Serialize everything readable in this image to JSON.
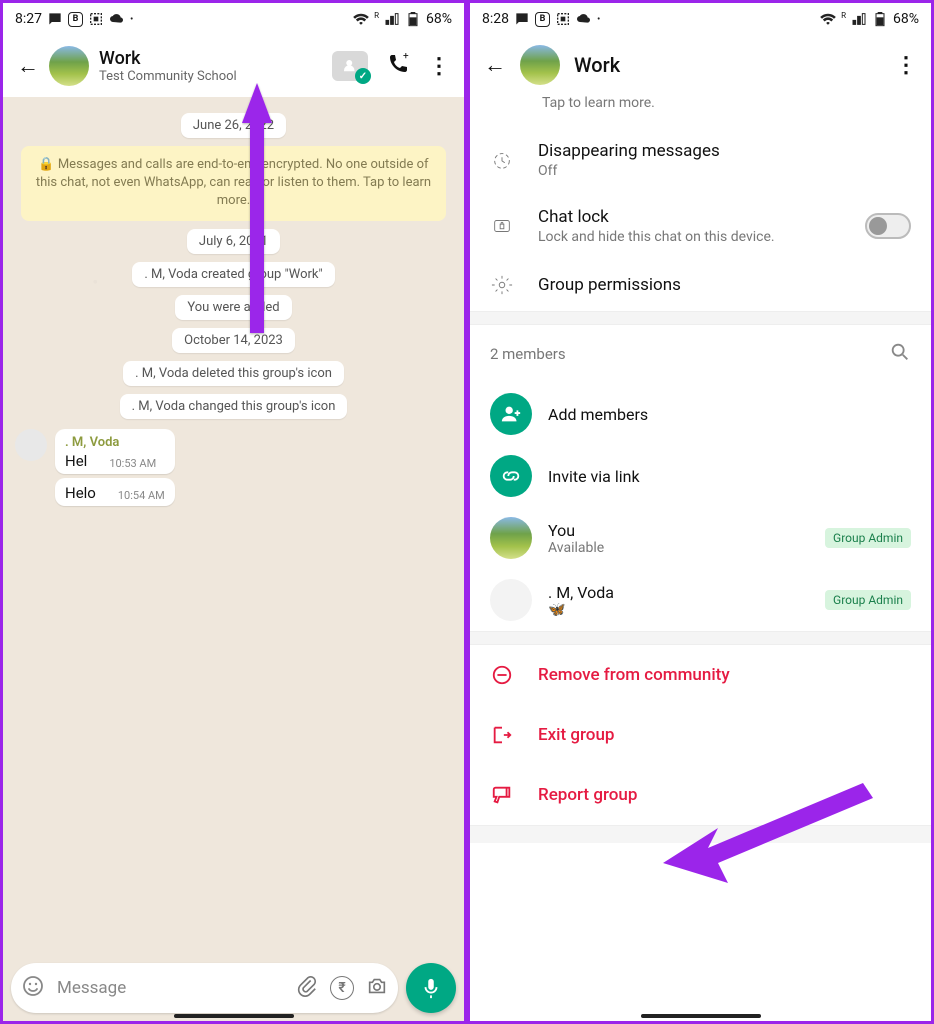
{
  "left": {
    "statusbar": {
      "time": "8:27",
      "battery": "68%",
      "roam": "R"
    },
    "header": {
      "title": "Work",
      "subtitle": "Test Community School"
    },
    "chat": {
      "dates": {
        "d1": "June 26, 2022",
        "d2": "July 6, 2021",
        "d3": "October 14, 2023"
      },
      "encryption": "🔒 Messages and calls are end-to-end encrypted. No one outside of this chat, not even WhatsApp, can read or listen to them. Tap to learn more.",
      "sys": {
        "created": ". M, Voda created group \"Work\"",
        "added": "You were added",
        "deleted_icon": ". M, Voda deleted this group's icon",
        "changed_icon": ". M, Voda changed this group's icon"
      },
      "message": {
        "sender": ". M, Voda",
        "m1_text": "Hel",
        "m1_time": "10:53 AM",
        "m2_text": "Helo",
        "m2_time": "10:54 AM"
      },
      "input_placeholder": "Message"
    }
  },
  "right": {
    "statusbar": {
      "time": "8:28",
      "battery": "68%",
      "roam": "R"
    },
    "header": {
      "title": "Work",
      "tap_sub": "Tap to learn more."
    },
    "options": {
      "disappearing": {
        "title": "Disappearing messages",
        "sub": "Off"
      },
      "chatlock": {
        "title": "Chat lock",
        "sub": "Lock and hide this chat on this device."
      },
      "permissions": {
        "title": "Group permissions"
      }
    },
    "members": {
      "count": "2 members",
      "add": "Add members",
      "invite": "Invite via link",
      "you": {
        "name": "You",
        "sub": "Available",
        "badge": "Group Admin"
      },
      "m2": {
        "name": ". M, Voda",
        "sub": "🦋",
        "badge": "Group Admin"
      }
    },
    "actions": {
      "remove": "Remove from community",
      "exit": "Exit group",
      "report": "Report group"
    }
  }
}
